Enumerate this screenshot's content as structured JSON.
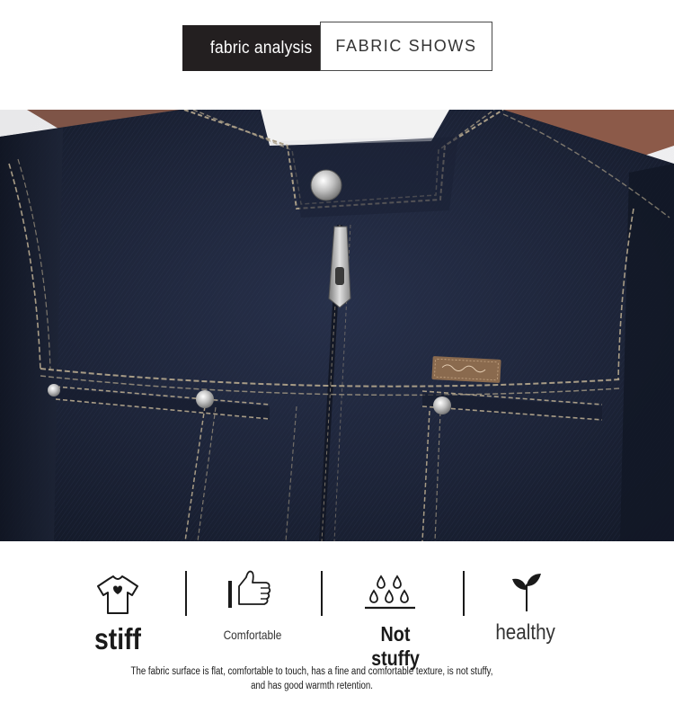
{
  "header": {
    "tab_active": "fabric analysis",
    "tab_inactive": "FABRIC SHOWS"
  },
  "photo": {
    "subject": "dark denim jacket close-up"
  },
  "features": [
    {
      "icon": "tshirt-icon",
      "label": "stiff"
    },
    {
      "icon": "thumbs-up-icon",
      "label": "Comfortable"
    },
    {
      "icon": "droplets-icon",
      "label": "Not stuffy"
    },
    {
      "icon": "sprout-icon",
      "label": "healthy"
    }
  ],
  "description": "The fabric surface is flat, comfortable to touch, has a fine and comfortable texture, is not stuffy, and has good warmth retention.",
  "colors": {
    "tab_dark": "#231f20",
    "denim": "#1c2333",
    "stitch": "#a89c86",
    "text": "#1a1a1a"
  }
}
